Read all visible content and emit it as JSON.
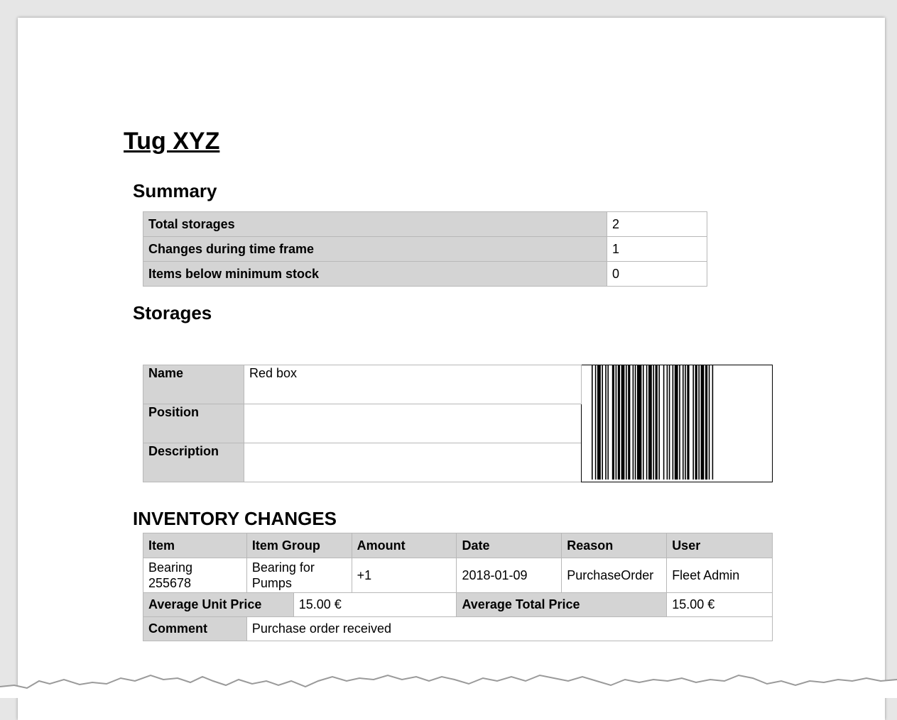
{
  "document": {
    "title": "Tug XYZ"
  },
  "summary": {
    "heading": "Summary",
    "rows": [
      {
        "label": "Total storages",
        "value": "2"
      },
      {
        "label": "Changes during time frame",
        "value": "1"
      },
      {
        "label": "Items below minimum stock",
        "value": "0"
      }
    ]
  },
  "storages": {
    "heading": "Storages",
    "name_label": "Name",
    "name_value": "Red box",
    "position_label": "Position",
    "position_value": "",
    "description_label": "Description",
    "description_value": ""
  },
  "inventory_changes": {
    "heading": "INVENTORY CHANGES",
    "columns": [
      "Item",
      "Item Group",
      "Amount",
      "Date",
      "Reason",
      "User"
    ],
    "rows": [
      {
        "item_line1": "Bearing",
        "item_line2": "255678",
        "item_group_line1": "Bearing for",
        "item_group_line2": "Pumps",
        "amount": "+1",
        "date": "2018-01-09",
        "reason": "PurchaseOrder",
        "user": "Fleet Admin"
      }
    ],
    "avg_unit_price_label": "Average Unit Price",
    "avg_unit_price_value": "15.00 €",
    "avg_total_price_label": "Average Total Price",
    "avg_total_price_value": "15.00 €",
    "comment_label": "Comment",
    "comment_value": "Purchase order received"
  }
}
